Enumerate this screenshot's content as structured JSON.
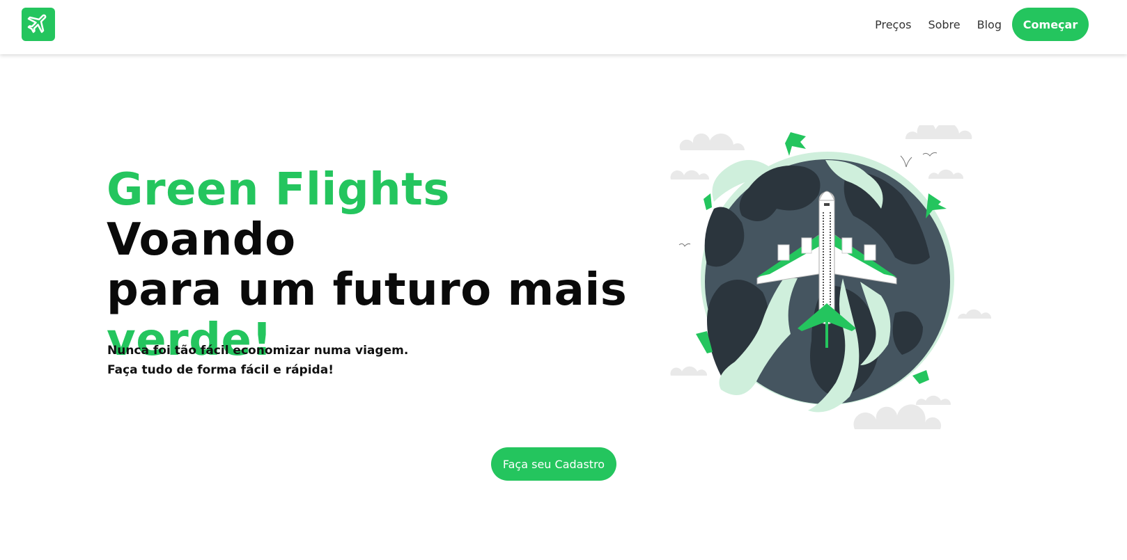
{
  "nav": {
    "logo_icon": "airplane-icon",
    "links": [
      {
        "label": "Preços"
      },
      {
        "label": "Sobre"
      },
      {
        "label": "Blog"
      }
    ],
    "cta_label": "Começar"
  },
  "hero": {
    "title_green_1": "Green Flights",
    "title_dark_1": " Voando",
    "title_dark_2": " para um futuro mais",
    "title_green_2": "verde!",
    "subtitle_line_1": "Nunca foi tão fácil economizar numa viagem.",
    "subtitle_line_2": "Faça tudo de forma fácil e rápida!",
    "signup_label": "Faça seu Cadastro"
  },
  "colors": {
    "brand_green": "#24c55e",
    "dark_text": "#0a0a0a",
    "globe_dark": "#2b353d",
    "globe_light": "#455560"
  },
  "illustration": {
    "icon": "globe-airplane-illustration"
  }
}
